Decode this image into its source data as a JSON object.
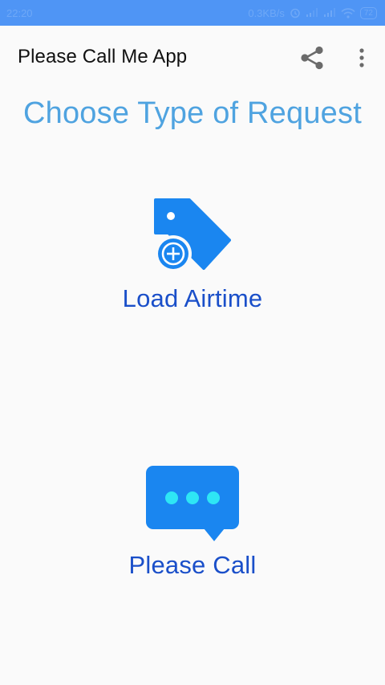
{
  "status_bar": {
    "time": "22:20",
    "network_speed": "0.3KB/s",
    "battery": "72"
  },
  "app_bar": {
    "title": "Please Call Me App",
    "share_icon": "share-icon",
    "more_icon": "more-vert-icon"
  },
  "main": {
    "heading": "Choose Type of Request",
    "options": [
      {
        "label": "Load Airtime",
        "icon": "tag-add-icon"
      },
      {
        "label": "Please Call",
        "icon": "chat-bubble-icon"
      }
    ]
  },
  "colors": {
    "status_bar": "#4f95f5",
    "heading": "#4fa3e0",
    "option_label": "#1a4fc9",
    "icon": "#1a86f0",
    "icon_dots": "#2ee6f5"
  }
}
